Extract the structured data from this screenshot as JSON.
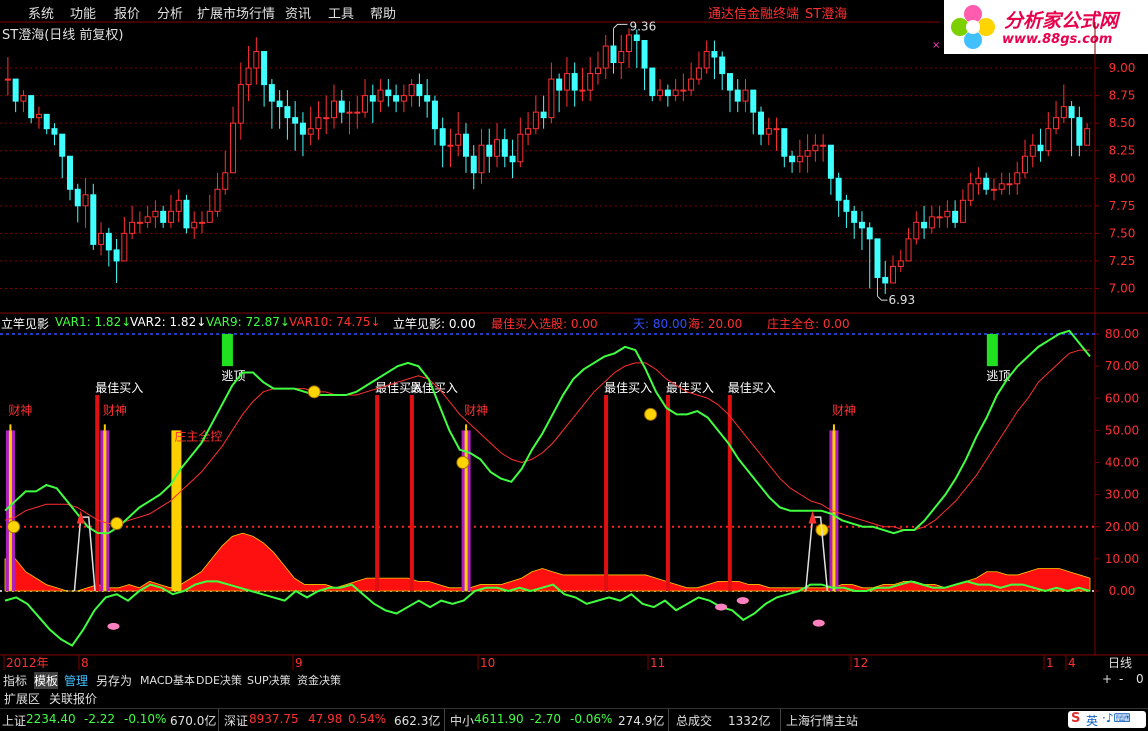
{
  "menu": {
    "items": [
      "系统",
      "功能",
      "报价",
      "分析",
      "扩展市场行情",
      "资讯",
      "工具",
      "帮助"
    ],
    "terminal_name": "通达信金融终端",
    "stock_name": "ST澄海"
  },
  "logo": {
    "title": "分析家公式网",
    "url": "www.88gs.com"
  },
  "stock_title": "ST澄海(日线 前复权)",
  "chart_data": [
    {
      "type": "candlestick",
      "title": "ST澄海(日线 前复权)",
      "y_ticks": [
        "9.00",
        "8.75",
        "8.50",
        "8.25",
        "8.00",
        "7.75",
        "7.50",
        "7.25",
        "7.00"
      ],
      "ylim": [
        6.85,
        9.3
      ],
      "annotations": [
        {
          "text": "9.36",
          "role": "high"
        },
        {
          "text": "6.93",
          "role": "low"
        }
      ],
      "closes": [
        8.9,
        8.7,
        8.75,
        8.55,
        8.58,
        8.45,
        8.4,
        8.2,
        7.9,
        7.75,
        7.85,
        7.4,
        7.5,
        7.35,
        7.25,
        7.5,
        7.6,
        7.6,
        7.65,
        7.7,
        7.6,
        7.7,
        7.8,
        7.55,
        7.6,
        7.6,
        7.7,
        7.9,
        8.05,
        8.5,
        8.85,
        9.0,
        9.15,
        8.85,
        8.7,
        8.65,
        8.55,
        8.5,
        8.4,
        8.45,
        8.55,
        8.55,
        8.7,
        8.6,
        8.6,
        8.6,
        8.75,
        8.7,
        8.8,
        8.75,
        8.7,
        8.75,
        8.85,
        8.75,
        8.7,
        8.45,
        8.3,
        8.3,
        8.4,
        8.2,
        8.05,
        8.3,
        8.2,
        8.35,
        8.2,
        8.15,
        8.4,
        8.45,
        8.6,
        8.55,
        8.9,
        8.8,
        8.95,
        8.8,
        8.8,
        8.95,
        9.0,
        9.2,
        9.05,
        9.15,
        9.3,
        9.25,
        9.0,
        8.75,
        8.8,
        8.75,
        8.8,
        8.8,
        8.9,
        9.0,
        9.15,
        9.1,
        8.95,
        8.8,
        8.7,
        8.8,
        8.6,
        8.4,
        8.45,
        8.45,
        8.2,
        8.15,
        8.2,
        8.25,
        8.3,
        8.3,
        8.0,
        7.8,
        7.7,
        7.6,
        7.55,
        7.45,
        7.1,
        7.05,
        7.2,
        7.25,
        7.45,
        7.6,
        7.55,
        7.65,
        7.65,
        7.7,
        7.6,
        7.8,
        7.95,
        8.0,
        7.9,
        7.9,
        7.95,
        7.95,
        8.05,
        8.2,
        8.3,
        8.25,
        8.45,
        8.55,
        8.65,
        8.55,
        8.3,
        8.45
      ],
      "highs": [
        9.1,
        8.9,
        8.8,
        8.75,
        8.65,
        8.55,
        8.5,
        8.4,
        8.2,
        7.95,
        8.0,
        7.95,
        7.6,
        7.55,
        7.45,
        7.65,
        7.75,
        7.7,
        7.75,
        7.8,
        7.75,
        7.85,
        7.9,
        7.85,
        7.7,
        7.7,
        7.85,
        8.05,
        8.25,
        8.65,
        9.05,
        9.2,
        9.28,
        9.15,
        8.9,
        8.8,
        8.8,
        8.7,
        8.6,
        8.65,
        8.7,
        8.75,
        8.85,
        8.8,
        8.7,
        8.75,
        8.9,
        8.85,
        8.9,
        8.9,
        8.85,
        8.85,
        8.9,
        8.95,
        8.9,
        8.75,
        8.55,
        8.45,
        8.6,
        8.5,
        8.3,
        8.45,
        8.45,
        8.5,
        8.45,
        8.35,
        8.55,
        8.6,
        8.75,
        8.75,
        9.05,
        8.95,
        9.1,
        9.05,
        9.0,
        9.1,
        9.15,
        9.3,
        9.36,
        9.3,
        9.36,
        9.35,
        9.2,
        8.95,
        8.9,
        8.85,
        8.9,
        8.95,
        9.05,
        9.15,
        9.25,
        9.25,
        9.15,
        8.95,
        8.9,
        8.9,
        8.8,
        8.65,
        8.55,
        8.55,
        8.45,
        8.25,
        8.35,
        8.4,
        8.4,
        8.4,
        8.3,
        8.05,
        7.85,
        7.75,
        7.7,
        7.6,
        7.45,
        7.25,
        7.3,
        7.35,
        7.55,
        7.7,
        7.75,
        7.75,
        7.75,
        7.8,
        7.8,
        7.9,
        8.05,
        8.1,
        8.05,
        8.0,
        8.05,
        8.05,
        8.15,
        8.35,
        8.4,
        8.45,
        8.6,
        8.7,
        8.85,
        8.7,
        8.65,
        8.5
      ],
      "lows": [
        8.75,
        8.6,
        8.6,
        8.5,
        8.45,
        8.4,
        8.3,
        8.0,
        7.8,
        7.6,
        7.55,
        7.35,
        7.3,
        7.2,
        7.05,
        7.25,
        7.45,
        7.5,
        7.55,
        7.55,
        7.55,
        7.55,
        7.6,
        7.5,
        7.45,
        7.5,
        7.6,
        7.65,
        7.85,
        8.05,
        8.35,
        8.7,
        8.85,
        8.65,
        8.45,
        8.45,
        8.35,
        8.25,
        8.2,
        8.3,
        8.35,
        8.4,
        8.45,
        8.5,
        8.4,
        8.45,
        8.55,
        8.5,
        8.6,
        8.65,
        8.6,
        8.6,
        8.65,
        8.65,
        8.55,
        8.3,
        8.1,
        8.1,
        8.2,
        8.05,
        7.9,
        7.95,
        8.05,
        8.1,
        8.1,
        8.0,
        8.1,
        8.3,
        8.4,
        8.45,
        8.5,
        8.6,
        8.65,
        8.65,
        8.7,
        8.7,
        8.85,
        8.9,
        8.95,
        8.9,
        9.0,
        9.0,
        8.8,
        8.7,
        8.7,
        8.65,
        8.7,
        8.7,
        8.75,
        8.85,
        8.95,
        8.9,
        8.8,
        8.6,
        8.6,
        8.6,
        8.4,
        8.3,
        8.3,
        8.25,
        8.1,
        8.05,
        8.05,
        8.05,
        8.15,
        8.15,
        7.85,
        7.65,
        7.55,
        7.45,
        7.35,
        7.0,
        6.93,
        6.95,
        7.05,
        7.15,
        7.25,
        7.4,
        7.45,
        7.5,
        7.55,
        7.55,
        7.55,
        7.6,
        7.75,
        7.85,
        7.85,
        7.8,
        7.85,
        7.85,
        7.85,
        8.0,
        8.1,
        8.15,
        8.2,
        8.4,
        8.5,
        8.2,
        8.2,
        8.4
      ]
    },
    {
      "type": "line",
      "indicator_name": "立竿见影",
      "y_ticks": [
        "80.00",
        "70.00",
        "60.00",
        "50.00",
        "40.00",
        "30.00",
        "20.00",
        "10.00",
        "0.00"
      ],
      "ylim": [
        -20,
        85
      ],
      "reference_lines": [
        80,
        20,
        0
      ],
      "x_labels": [
        "2012年",
        "8",
        "9",
        "10",
        "11",
        "12",
        "1",
        "4"
      ],
      "series": [
        {
          "name": "VAR9",
          "values": [
            25,
            28,
            31,
            31,
            33,
            32,
            28,
            24,
            20,
            18,
            18,
            20,
            23,
            26,
            28,
            30,
            33,
            38,
            42,
            46,
            52,
            58,
            64,
            68,
            68,
            65,
            63,
            63,
            63,
            62,
            61,
            61,
            61,
            61,
            62,
            64,
            66,
            68,
            70,
            71,
            70,
            66,
            58,
            50,
            44,
            43,
            41,
            37,
            35,
            34,
            38,
            44,
            49,
            55,
            61,
            66,
            69,
            71,
            73,
            74,
            76,
            75,
            69,
            62,
            57,
            55,
            55,
            56,
            54,
            50,
            46,
            41,
            37,
            33,
            29,
            26,
            25,
            25,
            25,
            25,
            24,
            22,
            21,
            20,
            20,
            19,
            18,
            19,
            19,
            22,
            26,
            30,
            35,
            41,
            48,
            54,
            61,
            66,
            70,
            73,
            76,
            78,
            80,
            81,
            77,
            73
          ]
        },
        {
          "name": "VAR10",
          "values": [
            22,
            23,
            25,
            26,
            27,
            27,
            27,
            26,
            24,
            22,
            21,
            21,
            22,
            23,
            24,
            26,
            28,
            31,
            34,
            37,
            41,
            45,
            50,
            55,
            59,
            62,
            63,
            63,
            63,
            63,
            62,
            62,
            61,
            61,
            61,
            62,
            63,
            64,
            65,
            66,
            67,
            66,
            63,
            59,
            55,
            52,
            49,
            46,
            43,
            41,
            40,
            41,
            43,
            46,
            50,
            54,
            58,
            62,
            65,
            68,
            70,
            71,
            71,
            69,
            66,
            64,
            62,
            61,
            60,
            58,
            55,
            51,
            47,
            43,
            39,
            35,
            32,
            30,
            28,
            27,
            25,
            24,
            23,
            22,
            21,
            20,
            20,
            19,
            19,
            20,
            22,
            25,
            28,
            32,
            36,
            41,
            46,
            51,
            56,
            60,
            65,
            68,
            71,
            74,
            75,
            75
          ]
        },
        {
          "name": "立竿见影",
          "values": [
            -3,
            -2,
            -4,
            -8,
            -12,
            -15,
            -17,
            -12,
            -6,
            -2,
            -1,
            -3,
            0,
            2,
            1,
            -1,
            0,
            2,
            3,
            3,
            2,
            1,
            0,
            -1,
            -2,
            -3,
            0,
            -2,
            0,
            1,
            1,
            2,
            -1,
            -4,
            -6,
            -7,
            -5,
            -3,
            -5,
            -3,
            -4,
            -3,
            0,
            1,
            1,
            0,
            1,
            0,
            1,
            2,
            -1,
            -2,
            -4,
            -3,
            -2,
            -3,
            -1,
            -4,
            -5,
            -3,
            -6,
            -4,
            -2,
            -3,
            -5,
            -6,
            -9,
            -7,
            -4,
            -2,
            -1,
            0,
            2,
            2,
            1,
            1,
            0,
            0,
            1,
            1,
            2,
            3,
            2,
            1,
            1,
            2,
            3,
            2,
            2,
            1,
            2,
            2,
            1,
            0,
            1,
            0,
            1,
            0
          ]
        }
      ],
      "bars": [
        {
          "label": "最佳买入",
          "color": "red"
        },
        {
          "label": "财神",
          "color": "purple"
        },
        {
          "label": "庄主全控",
          "color": "yellow"
        },
        {
          "label": "逃顶",
          "color": "green"
        }
      ],
      "bar_marks": [
        {
          "type": "财神",
          "position": 0.005
        },
        {
          "type": "最佳买入",
          "position": 0.085
        },
        {
          "type": "财神",
          "position": 0.092
        },
        {
          "type": "庄主全控",
          "position": 0.158
        },
        {
          "type": "逃顶",
          "position": 0.205
        },
        {
          "type": "最佳买入",
          "position": 0.343
        },
        {
          "type": "最佳买入",
          "position": 0.375
        },
        {
          "type": "财神",
          "position": 0.425
        },
        {
          "type": "最佳买入",
          "position": 0.554
        },
        {
          "type": "最佳买入",
          "position": 0.611
        },
        {
          "type": "最佳买入",
          "position": 0.668
        },
        {
          "type": "财神",
          "position": 0.764
        },
        {
          "type": "逃顶",
          "position": 0.91
        }
      ],
      "volume_area": [
        10,
        10,
        6,
        4,
        2,
        1,
        0,
        0,
        1,
        2,
        1,
        1,
        2,
        1,
        3,
        2,
        1,
        2,
        4,
        6,
        10,
        14,
        17,
        18,
        17,
        15,
        12,
        8,
        4,
        2,
        2,
        2,
        1,
        2,
        3,
        4,
        4,
        4,
        4,
        4,
        3,
        3,
        2,
        1,
        1,
        1,
        2,
        2,
        2,
        3,
        4,
        6,
        7,
        6,
        5,
        5,
        5,
        5,
        5,
        5,
        5,
        5,
        5,
        4,
        3,
        2,
        1,
        1,
        2,
        3,
        3,
        3,
        2,
        2,
        1,
        1,
        1,
        1,
        1,
        1,
        1,
        2,
        2,
        1,
        1,
        2,
        2,
        3,
        3,
        2,
        2,
        1,
        2,
        3,
        4,
        6,
        6,
        5,
        5,
        6,
        7,
        7,
        7,
        6,
        5,
        4
      ]
    }
  ],
  "indicator_header": [
    {
      "text": "立竿见影",
      "color": "#ffffff"
    },
    {
      "text": "VAR1: 1.82↓",
      "color": "#40ff40"
    },
    {
      "text": "VAR2: 1.82↓",
      "color": "#ffffff"
    },
    {
      "text": "VAR9: 72.87↓",
      "color": "#40ff40"
    },
    {
      "text": "VAR10: 74.75↓",
      "color": "#ff3030"
    },
    {
      "text": "立竿见影: 0.00",
      "color": "#ffffff"
    },
    {
      "text": "最佳买入选股: 0.00",
      "color": "#ff3030"
    },
    {
      "text": "天: 80.00",
      "color": "#3050ff"
    },
    {
      "text": "海: 20.00",
      "color": "#ff3030"
    },
    {
      "text": "庄主全仓: 0.00",
      "color": "#ff3030"
    }
  ],
  "right_tag": "日线",
  "tabs": [
    "指标",
    "模板",
    "管理",
    "另存为",
    "MACD基本",
    "DDE决策",
    "SUP决策",
    "资金决策"
  ],
  "tab_controls": [
    "+",
    "-",
    "0"
  ],
  "tabs2": [
    "扩展区",
    "关联报价"
  ],
  "status": {
    "sh_label": "上证",
    "sh_value": "2234.40",
    "sh_change": "-2.22",
    "sh_pct": "-0.10%",
    "sh_amount": "670.0亿",
    "sz_label": "深证",
    "sz_value": "8937.75",
    "sz_change": "47.98",
    "sz_pct": "0.54%",
    "sz_amount": "662.3亿",
    "zx_label": "中小",
    "zx_value": "4611.90",
    "zx_change": "-2.70",
    "zx_pct": "-0.06%",
    "zx_amount": "274.9亿",
    "total_label": "总成交",
    "total_value": "1332亿",
    "site": "上海行情主站",
    "ime": "英"
  },
  "colors": {
    "up": "#ff3030",
    "down": "#40ffff",
    "grid": "#800000",
    "var9": "#40ff40",
    "var10": "#ff3030",
    "zero": "#ffffff"
  }
}
